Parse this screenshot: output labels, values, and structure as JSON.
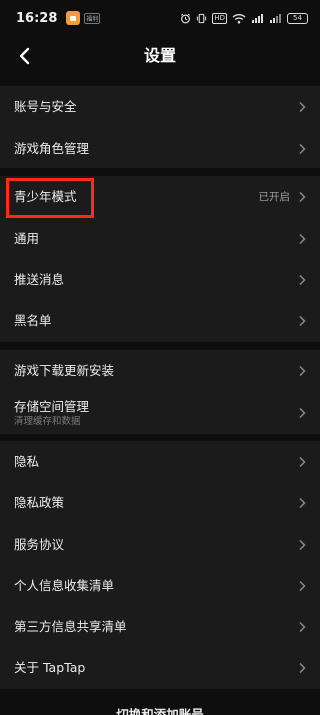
{
  "status_bar": {
    "time": "16:28",
    "app_badge": "福利",
    "network_badge": "HD",
    "signal_label": "5G",
    "battery": "54"
  },
  "header": {
    "title": "设置"
  },
  "groups": [
    {
      "items": [
        {
          "label": "账号与安全"
        },
        {
          "label": "游戏角色管理"
        }
      ]
    },
    {
      "items": [
        {
          "label": "青少年模式",
          "value": "已开启"
        },
        {
          "label": "通用"
        },
        {
          "label": "推送消息"
        },
        {
          "label": "黑名单"
        }
      ]
    },
    {
      "items": [
        {
          "label": "游戏下载更新安装"
        },
        {
          "label": "存储空间管理",
          "subtitle": "清理缓存和数据"
        }
      ]
    },
    {
      "items": [
        {
          "label": "隐私"
        },
        {
          "label": "隐私政策"
        },
        {
          "label": "服务协议"
        },
        {
          "label": "个人信息收集清单"
        },
        {
          "label": "第三方信息共享清单"
        },
        {
          "label": "关于 TapTap"
        }
      ]
    }
  ],
  "footer": {
    "label": "切换和添加账号"
  },
  "colors": {
    "background": "#0e0e0e",
    "group_background": "#1b1b1b",
    "highlight": "#ff2a1a"
  }
}
